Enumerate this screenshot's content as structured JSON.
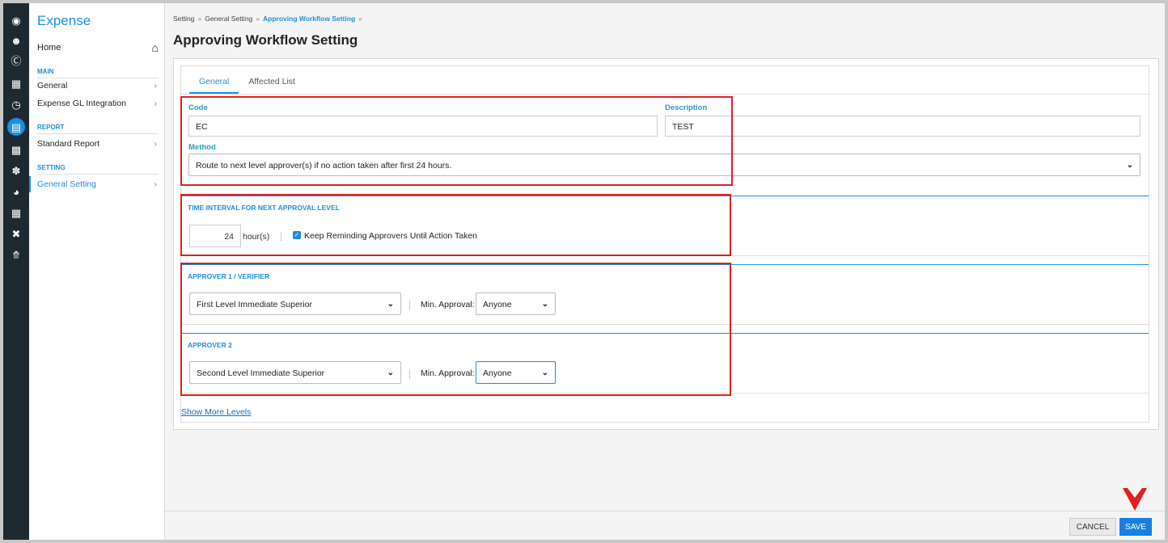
{
  "sidebar_rail": {
    "icons": [
      "dashboard-icon",
      "users-icon",
      "dollar-icon",
      "calendar-icon",
      "clock-icon",
      "expense-icon",
      "calendar-check-icon",
      "hand-money-icon",
      "pie-chart-icon",
      "grid-calendar-icon",
      "tools-icon",
      "upload-icon"
    ]
  },
  "menu": {
    "title": "Expense",
    "home_label": "Home",
    "sections": [
      {
        "label": "MAIN",
        "items": [
          {
            "label": "General"
          },
          {
            "label": "Expense GL Integration"
          }
        ]
      },
      {
        "label": "REPORT",
        "items": [
          {
            "label": "Standard Report"
          }
        ]
      },
      {
        "label": "SETTING",
        "items": [
          {
            "label": "General Setting"
          }
        ]
      }
    ]
  },
  "breadcrumb": {
    "items": [
      "Setting",
      "General Setting",
      "Approving Workflow Setting"
    ],
    "separator": "»"
  },
  "page_title": "Approving Workflow Setting",
  "tabs": [
    "General",
    "Affected List"
  ],
  "form": {
    "code_label": "Code",
    "code_value": "EC",
    "description_label": "Description",
    "description_value": "TEST",
    "method_label": "Method",
    "method_value": "Route to next level approver(s) if no action taken after first 24 hours."
  },
  "time_interval": {
    "title": "TIME INTERVAL FOR NEXT APPROVAL LEVEL",
    "hours_value": "24",
    "unit": "hour(s)",
    "keep_reminding_label": "Keep Reminding Approvers Until Action Taken",
    "keep_reminding_checked": true
  },
  "approvers": [
    {
      "title": "APPROVER 1 / VERIFIER",
      "approver_value": "First Level Immediate Superior",
      "min_approval_label": "Min. Approval:",
      "min_approval_value": "Anyone"
    },
    {
      "title": "APPROVER 2",
      "approver_value": "Second Level Immediate Superior",
      "min_approval_label": "Min. Approval:",
      "min_approval_value": "Anyone"
    }
  ],
  "show_more_label": "Show More Levels",
  "footer": {
    "cancel_label": "CANCEL",
    "save_label": "SAVE"
  },
  "colors": {
    "accent": "#1a8fe0",
    "highlight": "#e02020",
    "rail": "#1e2a32"
  }
}
